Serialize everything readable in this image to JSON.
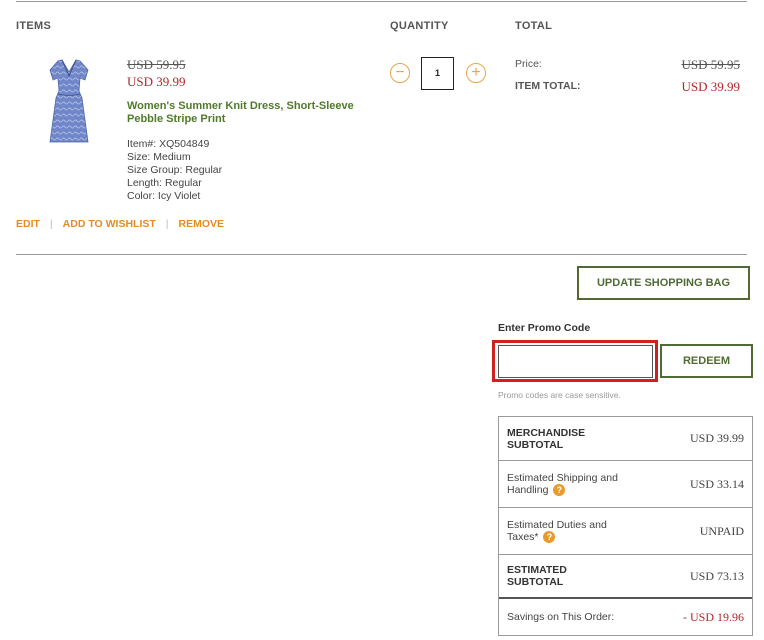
{
  "headers": {
    "items": "ITEMS",
    "quantity": "QUANTITY",
    "total": "TOTAL"
  },
  "item": {
    "original_price": "USD 59.95",
    "sale_price": "USD 39.99",
    "name": "Women's Summer Knit Dress, Short-Sleeve Pebble Stripe Print",
    "attributes": [
      "Item#: XQ504849",
      "Size: Medium",
      "Size Group: Regular",
      "Length: Regular",
      "Color: Icy Violet"
    ],
    "quantity": "1",
    "price_label": "Price:",
    "price_value": "USD 59.95",
    "item_total_label": "ITEM TOTAL:",
    "item_total_value": "USD 39.99"
  },
  "item_actions": {
    "edit": "EDIT",
    "wishlist": "ADD TO WISHLIST",
    "remove": "REMOVE"
  },
  "qty_controls": {
    "minus": "−",
    "plus": "+"
  },
  "update_button": "UPDATE SHOPPING BAG",
  "promo": {
    "label": "Enter Promo Code",
    "value": "",
    "redeem_label": "REDEEM",
    "note": "Promo codes are case sensitive."
  },
  "summary": {
    "merch_label": "MERCHANDISE SUBTOTAL",
    "merch_value": "USD 39.99",
    "shipping_label": "Estimated Shipping and Handling",
    "shipping_value": "USD 33.14",
    "duties_label": "Estimated Duties and Taxes*",
    "duties_value": "UNPAID",
    "est_label": "ESTIMATED SUBTOTAL",
    "est_value": "USD 73.13",
    "savings_label": "Savings on This Order:",
    "savings_value": "- USD 19.96",
    "help_glyph": "?"
  },
  "colors": {
    "accent_orange": "#e38b26",
    "brand_green": "#4f6b33",
    "sale_red": "#b0262c",
    "highlight_red": "#d0201f"
  }
}
